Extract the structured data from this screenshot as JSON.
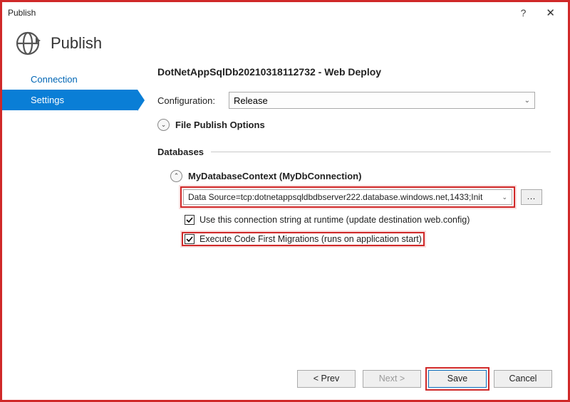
{
  "window": {
    "title": "Publish"
  },
  "header": {
    "title": "Publish"
  },
  "nav": {
    "items": [
      {
        "label": "Connection"
      },
      {
        "label": "Settings"
      }
    ]
  },
  "main": {
    "profile_title": "DotNetAppSqlDb20210318112732 - Web Deploy",
    "config_label": "Configuration:",
    "config_value": "Release",
    "file_publish_label": "File Publish Options",
    "databases_label": "Databases",
    "db_context_label": "MyDatabaseContext (MyDbConnection)",
    "conn_string_value": "Data Source=tcp:dotnetappsqldbdbserver222.database.windows.net,1433;Init",
    "browse_label": "...",
    "cb1_label": "Use this connection string at runtime (update destination web.config)",
    "cb2_label": "Execute Code First Migrations (runs on application start)"
  },
  "footer": {
    "prev": "< Prev",
    "next": "Next >",
    "save": "Save",
    "cancel": "Cancel"
  }
}
